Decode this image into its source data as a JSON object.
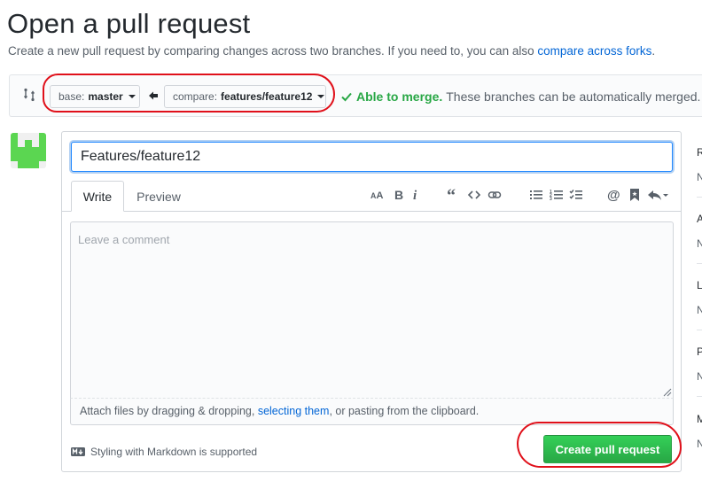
{
  "header": {
    "title": "Open a pull request",
    "subtitle_prefix": "Create a new pull request by comparing changes across two branches. If you need to, you can also ",
    "subtitle_link": "compare across forks",
    "subtitle_suffix": "."
  },
  "range_editor": {
    "base_label": "base:",
    "base_branch": "master",
    "compare_label": "compare:",
    "compare_branch": "features/feature12",
    "merge_ok": "Able to merge.",
    "merge_message": "These branches can be automatically merged."
  },
  "form": {
    "title_value": "Features/feature12",
    "tabs": [
      {
        "label": "Write",
        "active": true
      },
      {
        "label": "Preview",
        "active": false
      }
    ],
    "toolbar": [
      "header-icon",
      "bold-icon",
      "italic-icon",
      "quote-icon",
      "code-icon",
      "link-icon",
      "unordered-list-icon",
      "ordered-list-icon",
      "task-list-icon",
      "mention-icon",
      "bookmark-icon",
      "reply-icon"
    ],
    "comment_placeholder": "Leave a comment",
    "attach_prefix": "Attach files by dragging & dropping, ",
    "attach_link": "selecting them",
    "attach_suffix": ", or pasting from the clipboard.",
    "markdown_note": "Styling with Markdown is supported",
    "submit_label": "Create pull request"
  },
  "sidebar_fragments": [
    "R",
    "N",
    "A",
    "N",
    "L",
    "N",
    "P",
    "N",
    "M",
    "N"
  ],
  "colors": {
    "link": "#0366d6",
    "success": "#28a745",
    "annotation": "#e0101a",
    "avatar": "#5bd651"
  }
}
